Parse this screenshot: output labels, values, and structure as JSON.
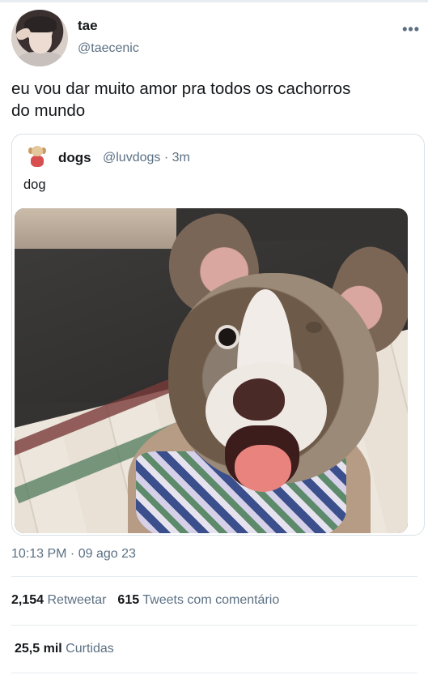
{
  "tweet": {
    "author": {
      "display_name": "tae",
      "handle": "@taecenic",
      "avatar_icon": "user-avatar"
    },
    "more_icon": "more-dots-icon",
    "text_line1": "eu vou dar muito amor pra todos os cachorros",
    "text_line2": "do mundo",
    "timestamp": "10:13 PM · 09 ago 23"
  },
  "quoted_tweet": {
    "display_name": "dogs",
    "meta": "@luvdogs · 3m",
    "text": "dog",
    "avatar_icon": "dog-avatar",
    "media": "dog-photo"
  },
  "stats": {
    "retweets_count": "2,154",
    "retweets_label": "Retweetar",
    "quotes_count": "615",
    "quotes_label": "Tweets com comentário",
    "likes_count": "25,5 mil",
    "likes_label": "Curtidas"
  },
  "colors": {
    "text_primary": "#14171a",
    "text_secondary": "#5b7083",
    "border": "#d9e1e7",
    "divider": "#e6ecf0"
  }
}
